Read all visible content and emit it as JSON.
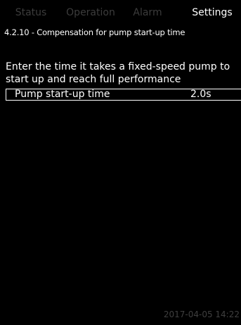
{
  "tabs": [
    {
      "label": "Status",
      "active": false
    },
    {
      "label": "Operation",
      "active": false
    },
    {
      "label": "Alarm",
      "active": false
    },
    {
      "label": "Settings",
      "active": true
    }
  ],
  "path": "4.2.10 - Compensation for pump start-up time",
  "description": "Enter the time it takes a fixed-speed pump to start up and reach full performance",
  "parameter": {
    "label": "Pump start-up time",
    "value": "2.0s"
  },
  "timestamp": "2017-04-05 14:22",
  "colors": {
    "background": "#000000",
    "text": "#ffffff",
    "inactive_tab": "#3c3c3c"
  }
}
